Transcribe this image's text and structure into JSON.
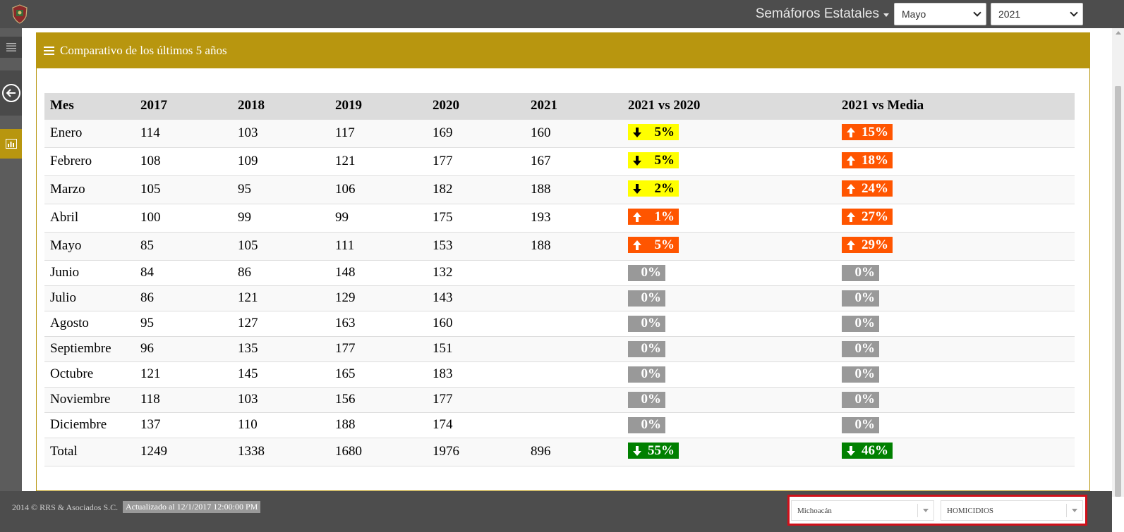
{
  "header": {
    "brand": "Semáforos Estatales",
    "month_select": "Mayo",
    "year_select": "2021"
  },
  "panel": {
    "title": "Comparativo de los últimos 5 años"
  },
  "table": {
    "headers": [
      "Mes",
      "2017",
      "2018",
      "2019",
      "2020",
      "2021",
      "2021 vs 2020",
      "2021 vs Media"
    ],
    "rows": [
      {
        "mes": "Enero",
        "y2017": "114",
        "y2018": "103",
        "y2019": "117",
        "y2020": "169",
        "y2021": "160",
        "vs2020": "5%",
        "vs2020_color": "yellow",
        "vs2020_dir": "down",
        "vsmedia": "15%",
        "vsmedia_color": "orange",
        "vsmedia_dir": "up"
      },
      {
        "mes": "Febrero",
        "y2017": "108",
        "y2018": "109",
        "y2019": "121",
        "y2020": "177",
        "y2021": "167",
        "vs2020": "5%",
        "vs2020_color": "yellow",
        "vs2020_dir": "down",
        "vsmedia": "18%",
        "vsmedia_color": "orange",
        "vsmedia_dir": "up"
      },
      {
        "mes": "Marzo",
        "y2017": "105",
        "y2018": "95",
        "y2019": "106",
        "y2020": "182",
        "y2021": "188",
        "vs2020": "2%",
        "vs2020_color": "yellow",
        "vs2020_dir": "down",
        "vsmedia": "24%",
        "vsmedia_color": "orange",
        "vsmedia_dir": "up"
      },
      {
        "mes": "Abril",
        "y2017": "100",
        "y2018": "99",
        "y2019": "99",
        "y2020": "175",
        "y2021": "193",
        "vs2020": "1%",
        "vs2020_color": "orange",
        "vs2020_dir": "up",
        "vsmedia": "27%",
        "vsmedia_color": "orange",
        "vsmedia_dir": "up"
      },
      {
        "mes": "Mayo",
        "y2017": "85",
        "y2018": "105",
        "y2019": "111",
        "y2020": "153",
        "y2021": "188",
        "vs2020": "5%",
        "vs2020_color": "orange",
        "vs2020_dir": "up",
        "vsmedia": "29%",
        "vsmedia_color": "orange",
        "vsmedia_dir": "up"
      },
      {
        "mes": "Junio",
        "y2017": "84",
        "y2018": "86",
        "y2019": "148",
        "y2020": "132",
        "y2021": "",
        "vs2020": "0%",
        "vs2020_color": "gray",
        "vs2020_dir": "none",
        "vsmedia": "0%",
        "vsmedia_color": "gray",
        "vsmedia_dir": "none"
      },
      {
        "mes": "Julio",
        "y2017": "86",
        "y2018": "121",
        "y2019": "129",
        "y2020": "143",
        "y2021": "",
        "vs2020": "0%",
        "vs2020_color": "gray",
        "vs2020_dir": "none",
        "vsmedia": "0%",
        "vsmedia_color": "gray",
        "vsmedia_dir": "none"
      },
      {
        "mes": "Agosto",
        "y2017": "95",
        "y2018": "127",
        "y2019": "163",
        "y2020": "160",
        "y2021": "",
        "vs2020": "0%",
        "vs2020_color": "gray",
        "vs2020_dir": "none",
        "vsmedia": "0%",
        "vsmedia_color": "gray",
        "vsmedia_dir": "none"
      },
      {
        "mes": "Septiembre",
        "y2017": "96",
        "y2018": "135",
        "y2019": "177",
        "y2020": "151",
        "y2021": "",
        "vs2020": "0%",
        "vs2020_color": "gray",
        "vs2020_dir": "none",
        "vsmedia": "0%",
        "vsmedia_color": "gray",
        "vsmedia_dir": "none"
      },
      {
        "mes": "Octubre",
        "y2017": "121",
        "y2018": "145",
        "y2019": "165",
        "y2020": "183",
        "y2021": "",
        "vs2020": "0%",
        "vs2020_color": "gray",
        "vs2020_dir": "none",
        "vsmedia": "0%",
        "vsmedia_color": "gray",
        "vsmedia_dir": "none"
      },
      {
        "mes": "Noviembre",
        "y2017": "118",
        "y2018": "103",
        "y2019": "156",
        "y2020": "177",
        "y2021": "",
        "vs2020": "0%",
        "vs2020_color": "gray",
        "vs2020_dir": "none",
        "vsmedia": "0%",
        "vsmedia_color": "gray",
        "vsmedia_dir": "none"
      },
      {
        "mes": "Diciembre",
        "y2017": "137",
        "y2018": "110",
        "y2019": "188",
        "y2020": "174",
        "y2021": "",
        "vs2020": "0%",
        "vs2020_color": "gray",
        "vs2020_dir": "none",
        "vsmedia": "0%",
        "vsmedia_color": "gray",
        "vsmedia_dir": "none"
      }
    ],
    "total": {
      "mes": "Total",
      "y2017": "1249",
      "y2018": "1338",
      "y2019": "1680",
      "y2020": "1976",
      "y2021": "896",
      "vs2020": "55%",
      "vs2020_color": "green",
      "vs2020_dir": "down",
      "vsmedia": "46%",
      "vsmedia_color": "green",
      "vsmedia_dir": "down"
    }
  },
  "footer": {
    "copyright": "2014 © RRS & Asociados S.C.",
    "updated": "Actualizado al 12/1/2017 12:00:00 PM",
    "state_select": "Michoacán",
    "crime_select": "HOMICIDIOS"
  },
  "colors": {
    "accent": "#b8960f",
    "yellow": "#ffff00",
    "orange": "#ff5500",
    "gray": "#999999",
    "green": "#008000",
    "highlight": "#d0101a"
  },
  "icons": {
    "logo": "shield-logo-icon",
    "menu": "hamburger-icon",
    "back": "back-arrow-circle-icon",
    "chart": "bar-chart-icon",
    "up": "arrow-up-icon",
    "down": "arrow-down-icon"
  }
}
